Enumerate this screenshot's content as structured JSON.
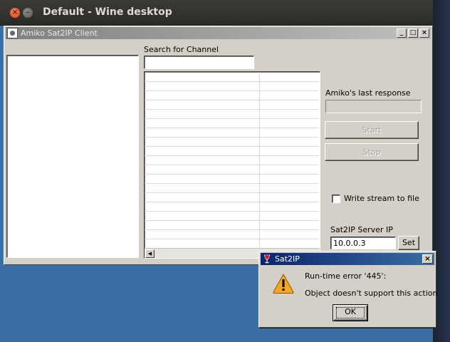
{
  "desktop": {
    "title": "Default - Wine desktop",
    "close_glyph": "×",
    "minimize_glyph": "–"
  },
  "app": {
    "title": "Amiko Sat2IP Client",
    "minimize_glyph": "_",
    "maximize_glyph": "□",
    "close_glyph": "×",
    "search_label": "Search for Channel",
    "search_value": "",
    "last_response_label": "Amiko's last response",
    "last_response_value": "",
    "start_label": "Start",
    "stop_label": "Stop",
    "write_stream_label": "Write stream to file",
    "write_stream_checked": false,
    "server_ip_label": "Sat2IP Server IP",
    "server_ip_value": "10.0.0.3",
    "set_label": "Set",
    "scroll_left_glyph": "◀"
  },
  "dialog": {
    "title": "Sat2IP",
    "close_glyph": "×",
    "message_line1": "Run-time error '445':",
    "message_line2": "Object doesn't support this action",
    "ok_label": "OK",
    "icon": "warning-icon"
  },
  "colors": {
    "desktop_blue": "#3a6ea5",
    "window_gray": "#d4d0c8",
    "dialog_title": "#0a246a",
    "warning_fill": "#f5c518"
  }
}
